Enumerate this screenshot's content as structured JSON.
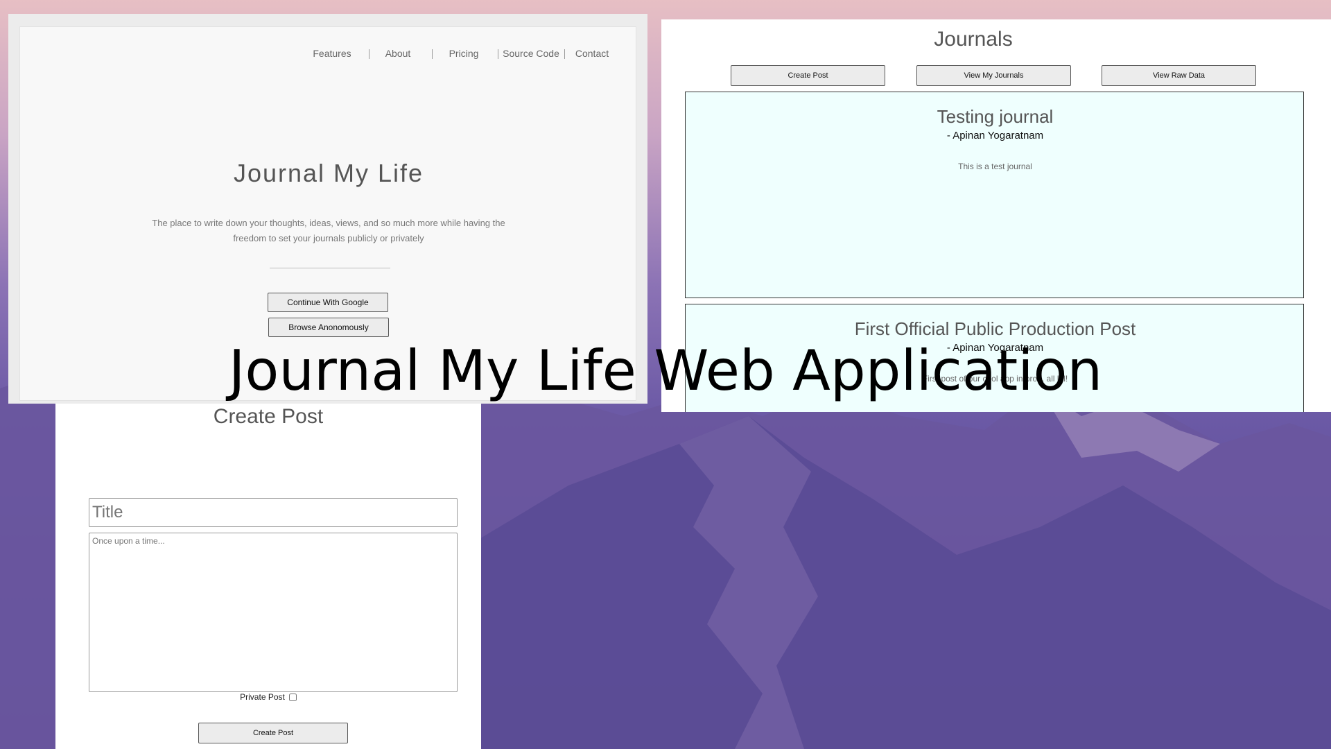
{
  "landing": {
    "nav": [
      "Features",
      "About",
      "Pricing",
      "Source Code",
      "Contact"
    ],
    "title": "Journal My Life",
    "subtitle": "The place to write down your thoughts, ideas, views, and so much more while having the freedom to set your journals publicly or privately",
    "google_button": "Continue With Google",
    "anon_button": "Browse Anonomously"
  },
  "journals": {
    "title": "Journals",
    "buttons": [
      "Create Post",
      "View My Journals",
      "View Raw Data"
    ],
    "cards": [
      {
        "title": "Testing journal",
        "author": "- Apinan Yogaratnam",
        "body": "This is a test journal"
      },
      {
        "title": "First Official Public Production Post",
        "author": "- Apinan Yogaratnam",
        "body": "First post of our cool app in prod. all lol!"
      }
    ],
    "card_bg": "#effffe"
  },
  "create_post": {
    "title": "Create Post",
    "title_placeholder": "Title",
    "body_placeholder": "Once upon a time...",
    "private_label": "Private Post",
    "private_checked": false,
    "submit_label": "Create Post"
  },
  "caption": "Journal My Life Web Application"
}
